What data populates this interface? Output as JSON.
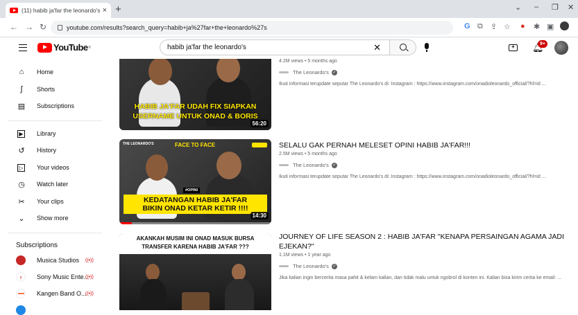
{
  "browser": {
    "tab_title": "(11) habib ja'far the leonardo's -",
    "tab_close": "×",
    "new_tab": "+",
    "url": "youtube.com/results?search_query=habib+ja%27far+the+leonardo%27s",
    "window_controls": [
      "⌄",
      "–",
      "❐",
      "✕"
    ]
  },
  "header": {
    "logo_text": "YouTube",
    "logo_reg": "®",
    "search_value": "habib ja'far the leonardo's",
    "notification_count": "9+"
  },
  "sidebar": {
    "items": [
      {
        "label": "Home",
        "icon": "home-icon",
        "glyph": "⌂"
      },
      {
        "label": "Shorts",
        "icon": "shorts-icon",
        "glyph": "ʃ"
      },
      {
        "label": "Subscriptions",
        "icon": "subscriptions-icon",
        "glyph": "▤"
      },
      {
        "label": "Library",
        "icon": "library-icon",
        "glyph": "▶"
      },
      {
        "label": "History",
        "icon": "history-icon",
        "glyph": "↺"
      },
      {
        "label": "Your videos",
        "icon": "your-videos-icon",
        "glyph": "▷"
      },
      {
        "label": "Watch later",
        "icon": "watch-later-icon",
        "glyph": "◷"
      },
      {
        "label": "Your clips",
        "icon": "clips-icon",
        "glyph": "✂"
      },
      {
        "label": "Show more",
        "icon": "chevron-down-icon",
        "glyph": "⌄"
      }
    ],
    "subscriptions_heading": "Subscriptions",
    "subscriptions": [
      {
        "name": "Musica Studios",
        "color": "#c62828",
        "live": "((•))"
      },
      {
        "name": "Sony Music Ente...",
        "color": "#e53935",
        "live": "((•))"
      },
      {
        "name": "Kangen Band O...",
        "color": "#ff7043",
        "live": "((•))"
      }
    ]
  },
  "results": [
    {
      "meta": "4.2M views • 5 months ago",
      "channel": "The Leonardo's",
      "description": "Ikuti informasi terupdate seputar The Leonardo's di: Instagram : https://www.instagram.com/onadioleonardo_official/?hl=id ...",
      "duration": "56:20",
      "thumb_caption_1": "HABIB JA'FAR UDAH FIX SIAPKAN",
      "thumb_caption_2": "USERNAME UNTUK ONAD & BORIS"
    },
    {
      "title": "SELALU GAK PERNAH MELESET OPINI HABIB JA'FAR!!!",
      "meta": "2.5M views • 5 months ago",
      "channel": "The Leonardo's",
      "description": "Ikuti informasi terupdate seputar The Leonardo's di: Instagram : https://www.instagram.com/onadioleonardo_official/?hl=id ...",
      "duration": "14:30",
      "thumb_top": "FACE TO FACE",
      "thumb_brand": "THE LEONARDO'S",
      "thumb_tag": "#OPINI",
      "thumb_caption_1": "KEDATANGAN HABIB JA'FAR",
      "thumb_caption_2": "BIKIN ONAD KETAR KETIR !!!!",
      "watched_fraction": 0.08
    },
    {
      "title": "JOURNEY OF LIFE SEASON 2 : HABIB JA'FAR \"KENAPA PERSAINGAN AGAMA JADI EJEKAN?\"",
      "meta": "1.1M views • 1 year ago",
      "channel": "The Leonardo's",
      "description": "Jika kalian ingin bercerita masa pahit & kelam kalian, dan tidak malu untuk ngobrol di konten ini. Kalian bisa kirim cerita ke email: ...",
      "thumb_caption_1": "AKANKAH MUSIM INI ONAD MASUK BURSA",
      "thumb_caption_2": "TRANSFER KARENA HABIB JA'FAR ???"
    }
  ],
  "colors": {
    "brand": "#ff0000",
    "thumb_caption_yellow": "#ffe500",
    "text_secondary": "#606060"
  }
}
